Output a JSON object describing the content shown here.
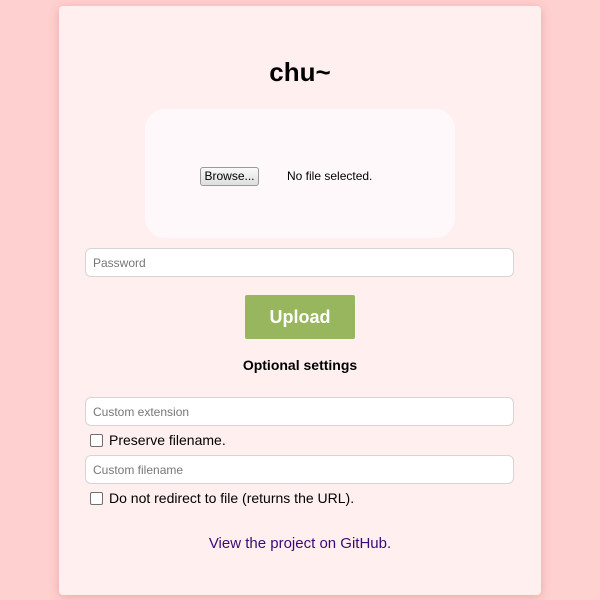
{
  "app": {
    "title": "chu~"
  },
  "upload": {
    "browse_label": "Browse...",
    "file_status": "No file selected.",
    "password_placeholder": "Password",
    "password_value": "",
    "submit_label": "Upload"
  },
  "optional": {
    "heading": "Optional settings",
    "extension_placeholder": "Custom extension",
    "extension_value": "",
    "preserve_label": "Preserve filename.",
    "preserve_checked": false,
    "filename_placeholder": "Custom filename",
    "filename_value": "",
    "no_redirect_label": "Do not redirect to file (returns the URL).",
    "no_redirect_checked": false
  },
  "footer": {
    "github_link": "View the project on GitHub."
  },
  "colors": {
    "page_background": "#ffd0cf",
    "card_background": "#fff0ef",
    "dropzone_background": "#fff8fb",
    "upload_button": "#97b65e",
    "link": "#3a0a7a"
  }
}
